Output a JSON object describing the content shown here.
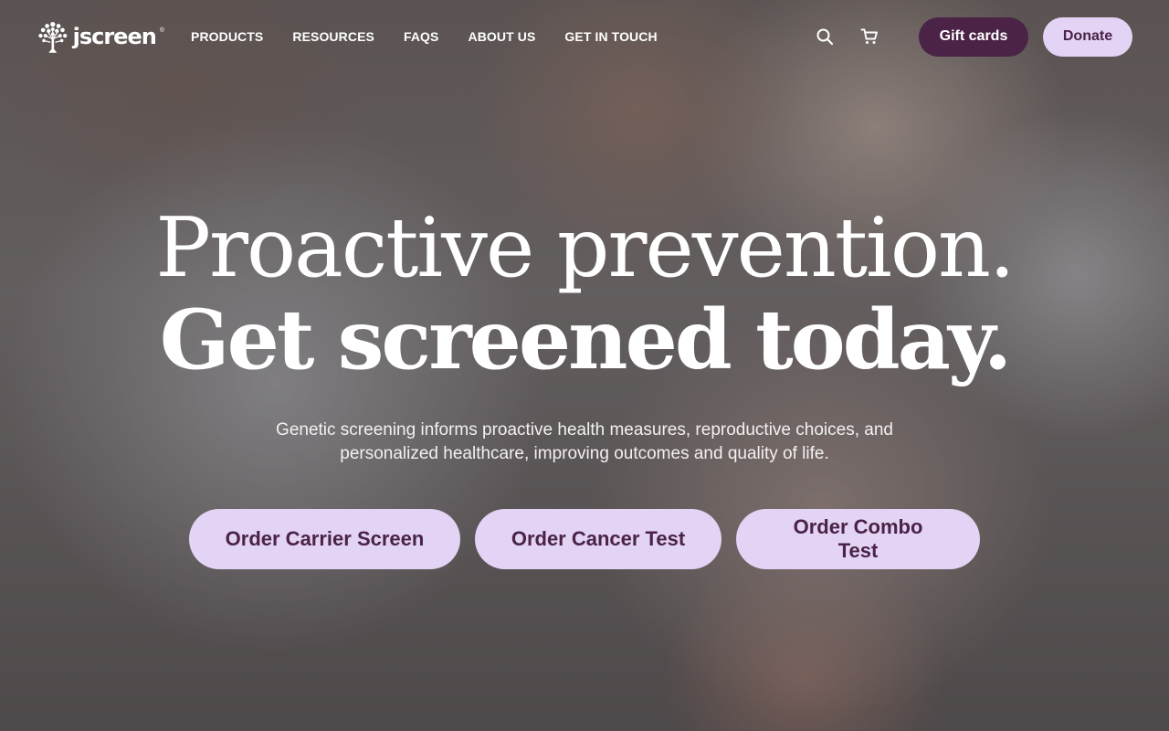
{
  "brand": {
    "name": "jscreen",
    "registered": "®",
    "colors": {
      "primary": "#4a2347",
      "accent": "#e3d3f4",
      "text_light": "#ffffff"
    },
    "logo_icon": "tree-icon"
  },
  "nav": {
    "items": [
      {
        "label": "PRODUCTS"
      },
      {
        "label": "RESOURCES"
      },
      {
        "label": "FAQS"
      },
      {
        "label": "ABOUT US"
      },
      {
        "label": "GET IN TOUCH"
      }
    ]
  },
  "header_actions": {
    "search_icon": "search-icon",
    "cart_icon": "cart-icon",
    "gift_cards_label": "Gift cards",
    "donate_label": "Donate"
  },
  "hero": {
    "headline_line1": "Proactive prevention.",
    "headline_line2": "Get screened today.",
    "subtext": "Genetic screening informs proactive health measures, reproductive choices, and personalized healthcare, improving outcomes and quality of life.",
    "ctas": [
      {
        "label": "Order Carrier Screen"
      },
      {
        "label": "Order Cancer Test"
      },
      {
        "label": "Order Combo Test"
      }
    ]
  }
}
